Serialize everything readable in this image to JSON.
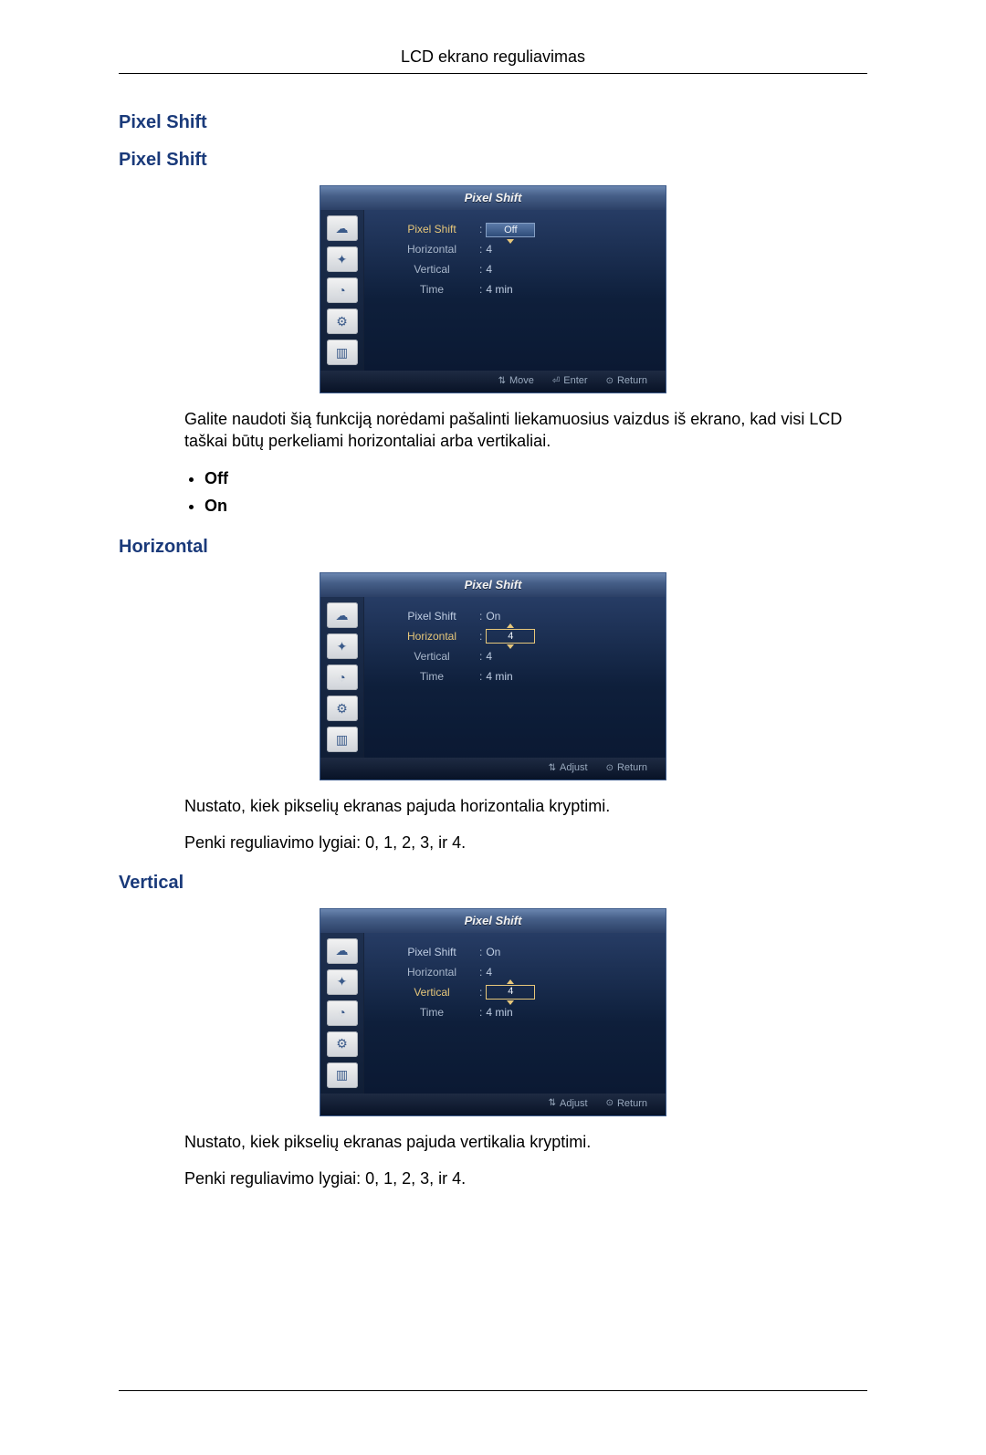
{
  "doc": {
    "header": "LCD ekrano reguliavimas",
    "section1_title": "Pixel Shift",
    "section1_sub": "Pixel Shift",
    "section1_desc": "Galite naudoti šią funkciją norėdami pašalinti liekamuosius vaizdus iš ekrano, kad visi LCD taškai būtų perkeliami horizontaliai arba vertikaliai.",
    "options": {
      "off": "Off",
      "on": "On"
    },
    "section2_title": "Horizontal",
    "section2_desc1": "Nustato, kiek pikselių ekranas pajuda horizontalia kryptimi.",
    "section2_desc2": "Penki reguliavimo lygiai: 0, 1, 2, 3, ir 4.",
    "section3_title": "Vertical",
    "section3_desc1": "Nustato, kiek pikselių ekranas pajuda vertikalia kryptimi.",
    "section3_desc2": "Penki reguliavimo lygiai: 0, 1, 2, 3, ir 4."
  },
  "osd_common": {
    "title": "Pixel Shift",
    "labels": {
      "pixel_shift": "Pixel Shift",
      "horizontal": "Horizontal",
      "vertical": "Vertical",
      "time": "Time"
    },
    "footer": {
      "move": "Move",
      "enter": "Enter",
      "return": "Return",
      "adjust": "Adjust"
    }
  },
  "osd1": {
    "pixel_shift_value": "Off",
    "horizontal_value": "4",
    "vertical_value": "4",
    "time_value": "4 min"
  },
  "osd2": {
    "pixel_shift_value": "On",
    "horizontal_value": "4",
    "vertical_value": "4",
    "time_value": "4 min"
  },
  "osd3": {
    "pixel_shift_value": "On",
    "horizontal_value": "4",
    "vertical_value": "4",
    "time_value": "4 min"
  },
  "icons": {
    "cloud": "cloud-icon",
    "star": "star-icon",
    "clock": "clock-icon",
    "gear": "gear-icon",
    "chart": "chart-icon"
  }
}
